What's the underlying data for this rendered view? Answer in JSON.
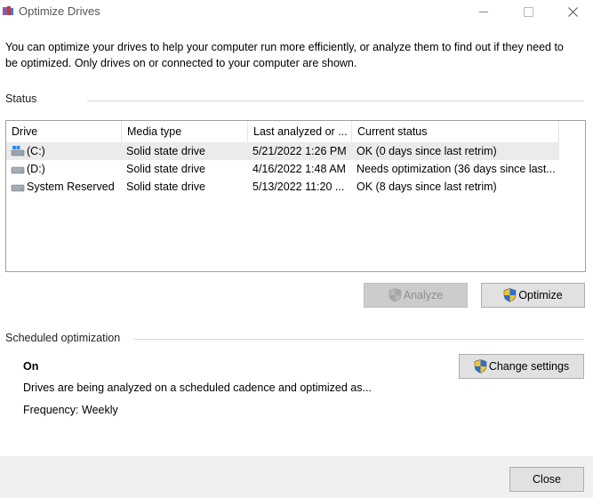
{
  "window": {
    "title": "Optimize Drives"
  },
  "description": "You can optimize your drives to help your computer run more efficiently, or analyze them to find out if they need to be optimized. Only drives on or connected to your computer are shown.",
  "status": {
    "section_label": "Status",
    "columns": [
      "Drive",
      "Media type",
      "Last analyzed or ...",
      "Current status"
    ],
    "drives": [
      {
        "drive": "(C:)",
        "media_type": "Solid state drive",
        "last_analyzed": "5/21/2022 1:26 PM",
        "status": "OK (0 days since last retrim)",
        "icon": "system-drive-icon",
        "selected": true
      },
      {
        "drive": "(D:)",
        "media_type": "Solid state drive",
        "last_analyzed": "4/16/2022 1:48 AM",
        "status": "Needs optimization (36 days since last...",
        "icon": "drive-icon",
        "selected": false
      },
      {
        "drive": "System Reserved",
        "media_type": "Solid state drive",
        "last_analyzed": "5/13/2022 11:20 ...",
        "status": "OK (8 days since last retrim)",
        "icon": "drive-icon",
        "selected": false
      }
    ]
  },
  "actions": {
    "analyze_label": "Analyze",
    "optimize_label": "Optimize"
  },
  "scheduled": {
    "section_label": "Scheduled optimization",
    "state": "On",
    "description": "Drives are being analyzed on a scheduled cadence and optimized as...",
    "frequency": "Frequency: Weekly",
    "change_settings_label": "Change settings"
  },
  "footer": {
    "close_label": "Close"
  },
  "colors": {
    "shield_blue": "#2a6fd1",
    "shield_yellow": "#f2c230",
    "disabled_bg": "#cccccc"
  }
}
